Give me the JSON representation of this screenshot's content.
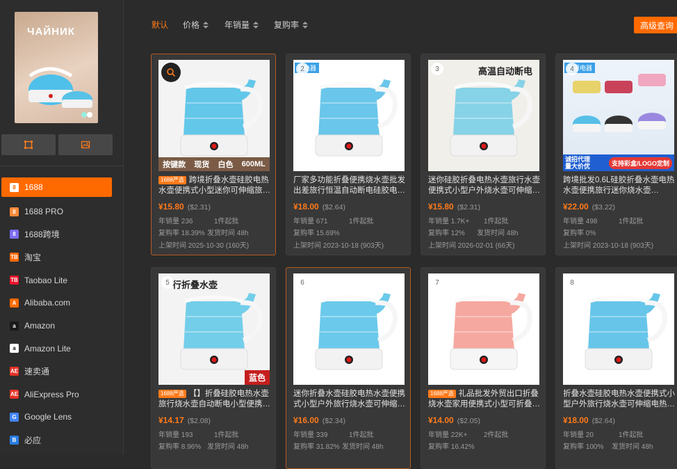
{
  "preview": {
    "brand_text": "ЧАЙНИК"
  },
  "sources": [
    {
      "label": "1688",
      "icon": "8",
      "color": "#ff6a00",
      "active": true
    },
    {
      "label": "1688 PRO",
      "icon": "8",
      "color": "#ff8a3a"
    },
    {
      "label": "1688跨境",
      "icon": "8",
      "color": "#7b6cf0"
    },
    {
      "label": "淘宝",
      "icon": "TB",
      "color": "#ff6a00"
    },
    {
      "label": "Taobao Lite",
      "icon": "TB",
      "color": "#e8132b"
    },
    {
      "label": "Alibaba.com",
      "icon": "A",
      "color": "#ff6a00"
    },
    {
      "label": "Amazon",
      "icon": "a",
      "color": "#1a1a1a"
    },
    {
      "label": "Amazon Lite",
      "icon": "a",
      "color": "#ffffff"
    },
    {
      "label": "速卖通",
      "icon": "AE",
      "color": "#e43226"
    },
    {
      "label": "AliExpress Pro",
      "icon": "AE",
      "color": "#e43226"
    },
    {
      "label": "Google Lens",
      "icon": "G",
      "color": "#4285f4"
    },
    {
      "label": "必应",
      "icon": "B",
      "color": "#2a7de1"
    }
  ],
  "sort": {
    "default": "默认",
    "price": "价格",
    "annual_sales": "年销量",
    "repurchase": "复购率",
    "advanced": "高级查询"
  },
  "labels": {
    "annual_sales": "年销量",
    "repurchase": "复购率",
    "moq_suffix": "件起批",
    "ship": "发货时间",
    "listed": "上架时间"
  },
  "products": [
    {
      "n": "1",
      "badge": "1688严选",
      "title": "跨境折叠水壶硅胶电热水壶便携式小型迷你可伸缩旅…",
      "price": "¥15.80",
      "usd": "($2.31)",
      "sales": "年销量 236",
      "moq": "1件起批",
      "rep": "复购率 18.39%",
      "ship": "发货时间 48h",
      "listed": "上架时间 2025-10-30 (160天)",
      "overlay_left": "按键款",
      "overlay_mid": "现货",
      "overlay_right": "白色",
      "overlay_size": "600ML",
      "color": "#5bc4e8"
    },
    {
      "n": "2",
      "badge": "",
      "title": "厂家多功能折叠便携烧水壶批发出差旅行恒温自动断电硅胶电…",
      "price": "¥18.00",
      "usd": "($2.64)",
      "sales": "年销量 671",
      "moq": "1件起批",
      "rep": "复购率 15.69%",
      "ship": "",
      "listed": "上架时间 2023-10-18 (903天)",
      "tag": "源电器",
      "color": "#62c3e9"
    },
    {
      "n": "3",
      "badge": "",
      "title": "迷你硅胶折叠电热水壶旅行水壶便携式小型户外烧水壶可伸缩…",
      "price": "¥15.80",
      "usd": "($2.31)",
      "sales": "年销量 1.7K+",
      "moq": "1件起批",
      "rep": "复购率 12%",
      "ship": "发货时间 48h",
      "listed": "上架时间 2026-02-01 (66天)",
      "headline": "高温自动断电",
      "color": "#7fd0e6"
    },
    {
      "n": "4",
      "badge": "",
      "title": "跨境批发0.6L硅胶折叠水壶电热水壶便携旅行迷你烧水壶…",
      "price": "¥22.00",
      "usd": "($3.22)",
      "sales": "年销量 498",
      "moq": "1件起批",
      "rep": "复购率 0%",
      "ship": "",
      "listed": "上架时间 2023-10-18 (903天)",
      "tag": "品源电器",
      "foot_left": "诚招代理 量大价优",
      "foot_right": "支持彩盒/LOGO定制",
      "color": "#58b8e0"
    },
    {
      "n": "5",
      "badge": "1688严选",
      "title": "【】折叠硅胶电热水壶旅行烧水壶自动断电小型便携…",
      "price": "¥14.17",
      "usd": "($2.08)",
      "sales": "年销量 193",
      "moq": "1件起批",
      "rep": "复购率 8.96%",
      "ship": "发货时间 48h",
      "listed": "",
      "headline": "行折叠水壶",
      "overlay_right": "蓝色",
      "color": "#6ccbe8"
    },
    {
      "n": "6",
      "badge": "",
      "title": "迷你折叠水壶硅胶电热水壶便携式小型户外旅行烧水壶可伸缩…",
      "price": "¥16.00",
      "usd": "($2.34)",
      "sales": "年销量 339",
      "moq": "1件起批",
      "rep": "复购率 31.82%",
      "ship": "发货时间 48h",
      "listed": "",
      "color": "#63c6ea"
    },
    {
      "n": "7",
      "badge": "1688严选",
      "title": "礼品批发外贸出口折叠烧水壶家用便携式小型可折叠…",
      "price": "¥14.00",
      "usd": "($2.05)",
      "sales": "年销量 22K+",
      "moq": "2件起批",
      "rep": "复购率 16.42%",
      "ship": "",
      "listed": "",
      "color": "#f4a39a"
    },
    {
      "n": "8",
      "badge": "",
      "title": "折叠水壶硅胶电热水壶便携式小型户外旅行烧水壶可伸缩电热…",
      "price": "¥18.00",
      "usd": "($2.64)",
      "sales": "年销量 20",
      "moq": "1件起批",
      "rep": "复购率 100%",
      "ship": "发货时间 48h",
      "listed": "",
      "color": "#5fc2e8"
    }
  ]
}
